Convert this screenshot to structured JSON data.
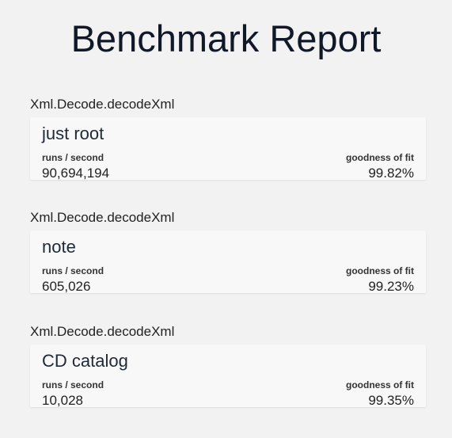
{
  "page": {
    "title": "Benchmark Report"
  },
  "groups": [
    {
      "title": "Xml.Decode.decodeXml",
      "card": {
        "name": "just root",
        "runs_label": "runs / second",
        "runs_value": "90,694,194",
        "fit_label": "goodness of fit",
        "fit_value": "99.82%"
      }
    },
    {
      "title": "Xml.Decode.decodeXml",
      "card": {
        "name": "note",
        "runs_label": "runs / second",
        "runs_value": "605,026",
        "fit_label": "goodness of fit",
        "fit_value": "99.23%"
      }
    },
    {
      "title": "Xml.Decode.decodeXml",
      "card": {
        "name": "CD catalog",
        "runs_label": "runs / second",
        "runs_value": "10,028",
        "fit_label": "goodness of fit",
        "fit_value": "99.35%"
      }
    }
  ]
}
